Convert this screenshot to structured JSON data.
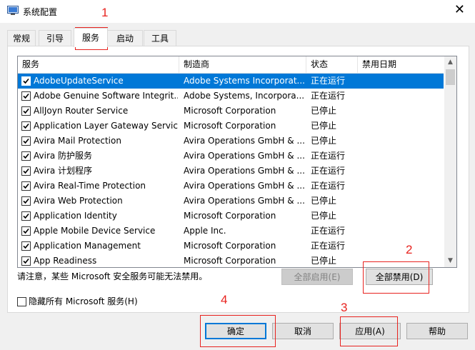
{
  "window": {
    "title": "系统配置",
    "close_glyph": "✕"
  },
  "tabs": [
    {
      "label": "常规"
    },
    {
      "label": "引导"
    },
    {
      "label": "服务",
      "active": true
    },
    {
      "label": "启动"
    },
    {
      "label": "工具"
    }
  ],
  "services": {
    "columns": [
      "服务",
      "制造商",
      "状态",
      "禁用日期"
    ],
    "rows": [
      {
        "name": "AdobeUpdateService",
        "vendor": "Adobe Systems Incorporat...",
        "status": "正在运行",
        "checked": true,
        "selected": true
      },
      {
        "name": "Adobe Genuine Software Integrit...",
        "vendor": "Adobe Systems, Incorpora...",
        "status": "正在运行",
        "checked": true
      },
      {
        "name": "AllJoyn Router Service",
        "vendor": "Microsoft Corporation",
        "status": "已停止",
        "checked": true
      },
      {
        "name": "Application Layer Gateway Service",
        "vendor": "Microsoft Corporation",
        "status": "已停止",
        "checked": true
      },
      {
        "name": "Avira Mail Protection",
        "vendor": "Avira Operations GmbH & ...",
        "status": "已停止",
        "checked": true
      },
      {
        "name": "Avira 防护服务",
        "vendor": "Avira Operations GmbH & ...",
        "status": "正在运行",
        "checked": true
      },
      {
        "name": "Avira 计划程序",
        "vendor": "Avira Operations GmbH & ...",
        "status": "正在运行",
        "checked": true
      },
      {
        "name": "Avira Real-Time Protection",
        "vendor": "Avira Operations GmbH & ...",
        "status": "正在运行",
        "checked": true
      },
      {
        "name": "Avira Web Protection",
        "vendor": "Avira Operations GmbH & ...",
        "status": "已停止",
        "checked": true
      },
      {
        "name": "Application Identity",
        "vendor": "Microsoft Corporation",
        "status": "已停止",
        "checked": true
      },
      {
        "name": "Apple Mobile Device Service",
        "vendor": "Apple Inc.",
        "status": "正在运行",
        "checked": true
      },
      {
        "name": "Application Management",
        "vendor": "Microsoft Corporation",
        "status": "正在运行",
        "checked": true
      },
      {
        "name": "App Readiness",
        "vendor": "Microsoft Corporation",
        "status": "已停止",
        "checked": true
      }
    ]
  },
  "note": "请注意，某些 Microsoft 安全服务可能无法禁用。",
  "buttons": {
    "enable_all": "全部启用(E)",
    "disable_all": "全部禁用(D)",
    "ok": "确定",
    "cancel": "取消",
    "apply": "应用(A)",
    "help": "帮助"
  },
  "hide_ms": {
    "label": "隐藏所有 Microsoft 服务(H)",
    "checked": false
  },
  "annotations": [
    "1",
    "2",
    "3",
    "4"
  ],
  "colors": {
    "selection": "#0078d7",
    "annotation": "#e8231f"
  }
}
